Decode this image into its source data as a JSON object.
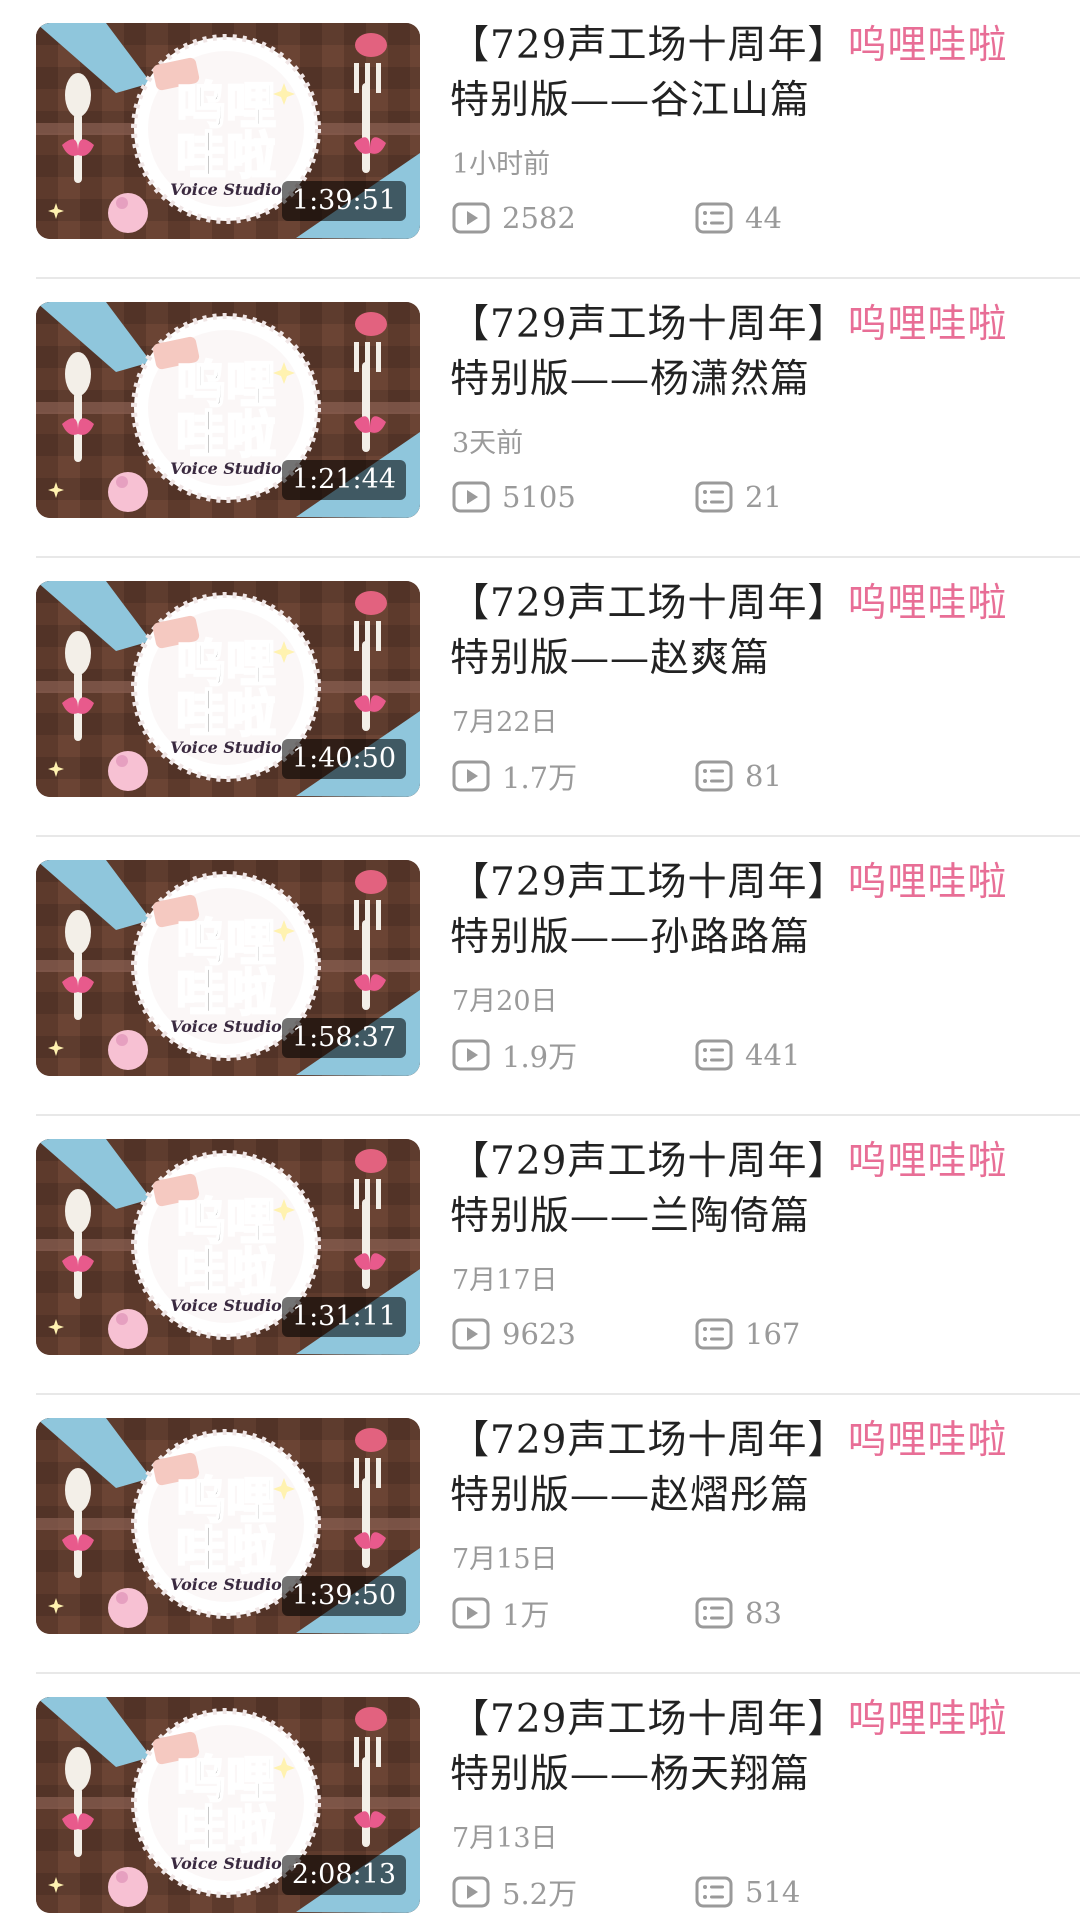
{
  "colors": {
    "accent": "#e86e96",
    "meta_text": "#9a9a9a",
    "thumb_bg": "#5a3a2e",
    "divider": "#e8e8e8"
  },
  "thumbnail_text": {
    "line1": "呜哩",
    "line2": "哇啦",
    "brand": "Voice Studio"
  },
  "videos": [
    {
      "title_prefix": "【729声工场十周年】",
      "title_tag": "呜哩哇啦",
      "title_suffix": "特别版——谷江山篇",
      "duration": "1:39:51",
      "date": "1小时前",
      "plays": "2582",
      "comments": "44",
      "play_icon": "play-icon",
      "comment_icon": "comment-list-icon"
    },
    {
      "title_prefix": "【729声工场十周年】",
      "title_tag": "呜哩哇啦",
      "title_suffix": "特别版——杨潇然篇",
      "duration": "1:21:44",
      "date": "3天前",
      "plays": "5105",
      "comments": "21",
      "play_icon": "play-icon",
      "comment_icon": "comment-list-icon"
    },
    {
      "title_prefix": "【729声工场十周年】",
      "title_tag": "呜哩哇啦",
      "title_suffix": "特别版——赵爽篇",
      "duration": "1:40:50",
      "date": "7月22日",
      "plays": "1.7万",
      "comments": "81",
      "play_icon": "play-icon",
      "comment_icon": "comment-list-icon"
    },
    {
      "title_prefix": "【729声工场十周年】",
      "title_tag": "呜哩哇啦",
      "title_suffix": "特别版——孙路路篇",
      "duration": "1:58:37",
      "date": "7月20日",
      "plays": "1.9万",
      "comments": "441",
      "play_icon": "play-icon",
      "comment_icon": "comment-list-icon"
    },
    {
      "title_prefix": "【729声工场十周年】",
      "title_tag": "呜哩哇啦",
      "title_suffix": "特别版——兰陶倚篇",
      "duration": "1:31:11",
      "date": "7月17日",
      "plays": "9623",
      "comments": "167",
      "play_icon": "play-icon",
      "comment_icon": "comment-list-icon"
    },
    {
      "title_prefix": "【729声工场十周年】",
      "title_tag": "呜哩哇啦",
      "title_suffix": "特别版——赵熠彤篇",
      "duration": "1:39:50",
      "date": "7月15日",
      "plays": "1万",
      "comments": "83",
      "play_icon": "play-icon",
      "comment_icon": "comment-list-icon"
    },
    {
      "title_prefix": "【729声工场十周年】",
      "title_tag": "呜哩哇啦",
      "title_suffix": "特别版——杨天翔篇",
      "duration": "2:08:13",
      "date": "7月13日",
      "plays": "5.2万",
      "comments": "514",
      "play_icon": "play-icon",
      "comment_icon": "comment-list-icon"
    }
  ]
}
